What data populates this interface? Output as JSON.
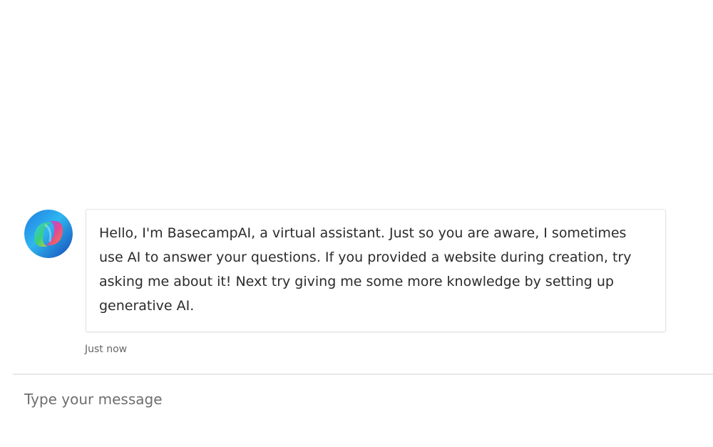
{
  "conversation": {
    "messages": [
      {
        "sender": "bot",
        "avatar_icon": "copilot-logo-icon",
        "text": "Hello, I'm BasecampAI, a virtual assistant. Just so you are aware, I sometimes use AI to answer your questions. If you provided a website during creation, try asking me about it! Next try giving me some more knowledge by setting up generative AI.",
        "timestamp": "Just now"
      }
    ]
  },
  "composer": {
    "placeholder": "Type your message",
    "value": ""
  },
  "colors": {
    "bubble_border": "#e3e3e3",
    "divider": "#e8e8e8",
    "text": "#2b2b2b",
    "placeholder": "#6e6e6e"
  }
}
